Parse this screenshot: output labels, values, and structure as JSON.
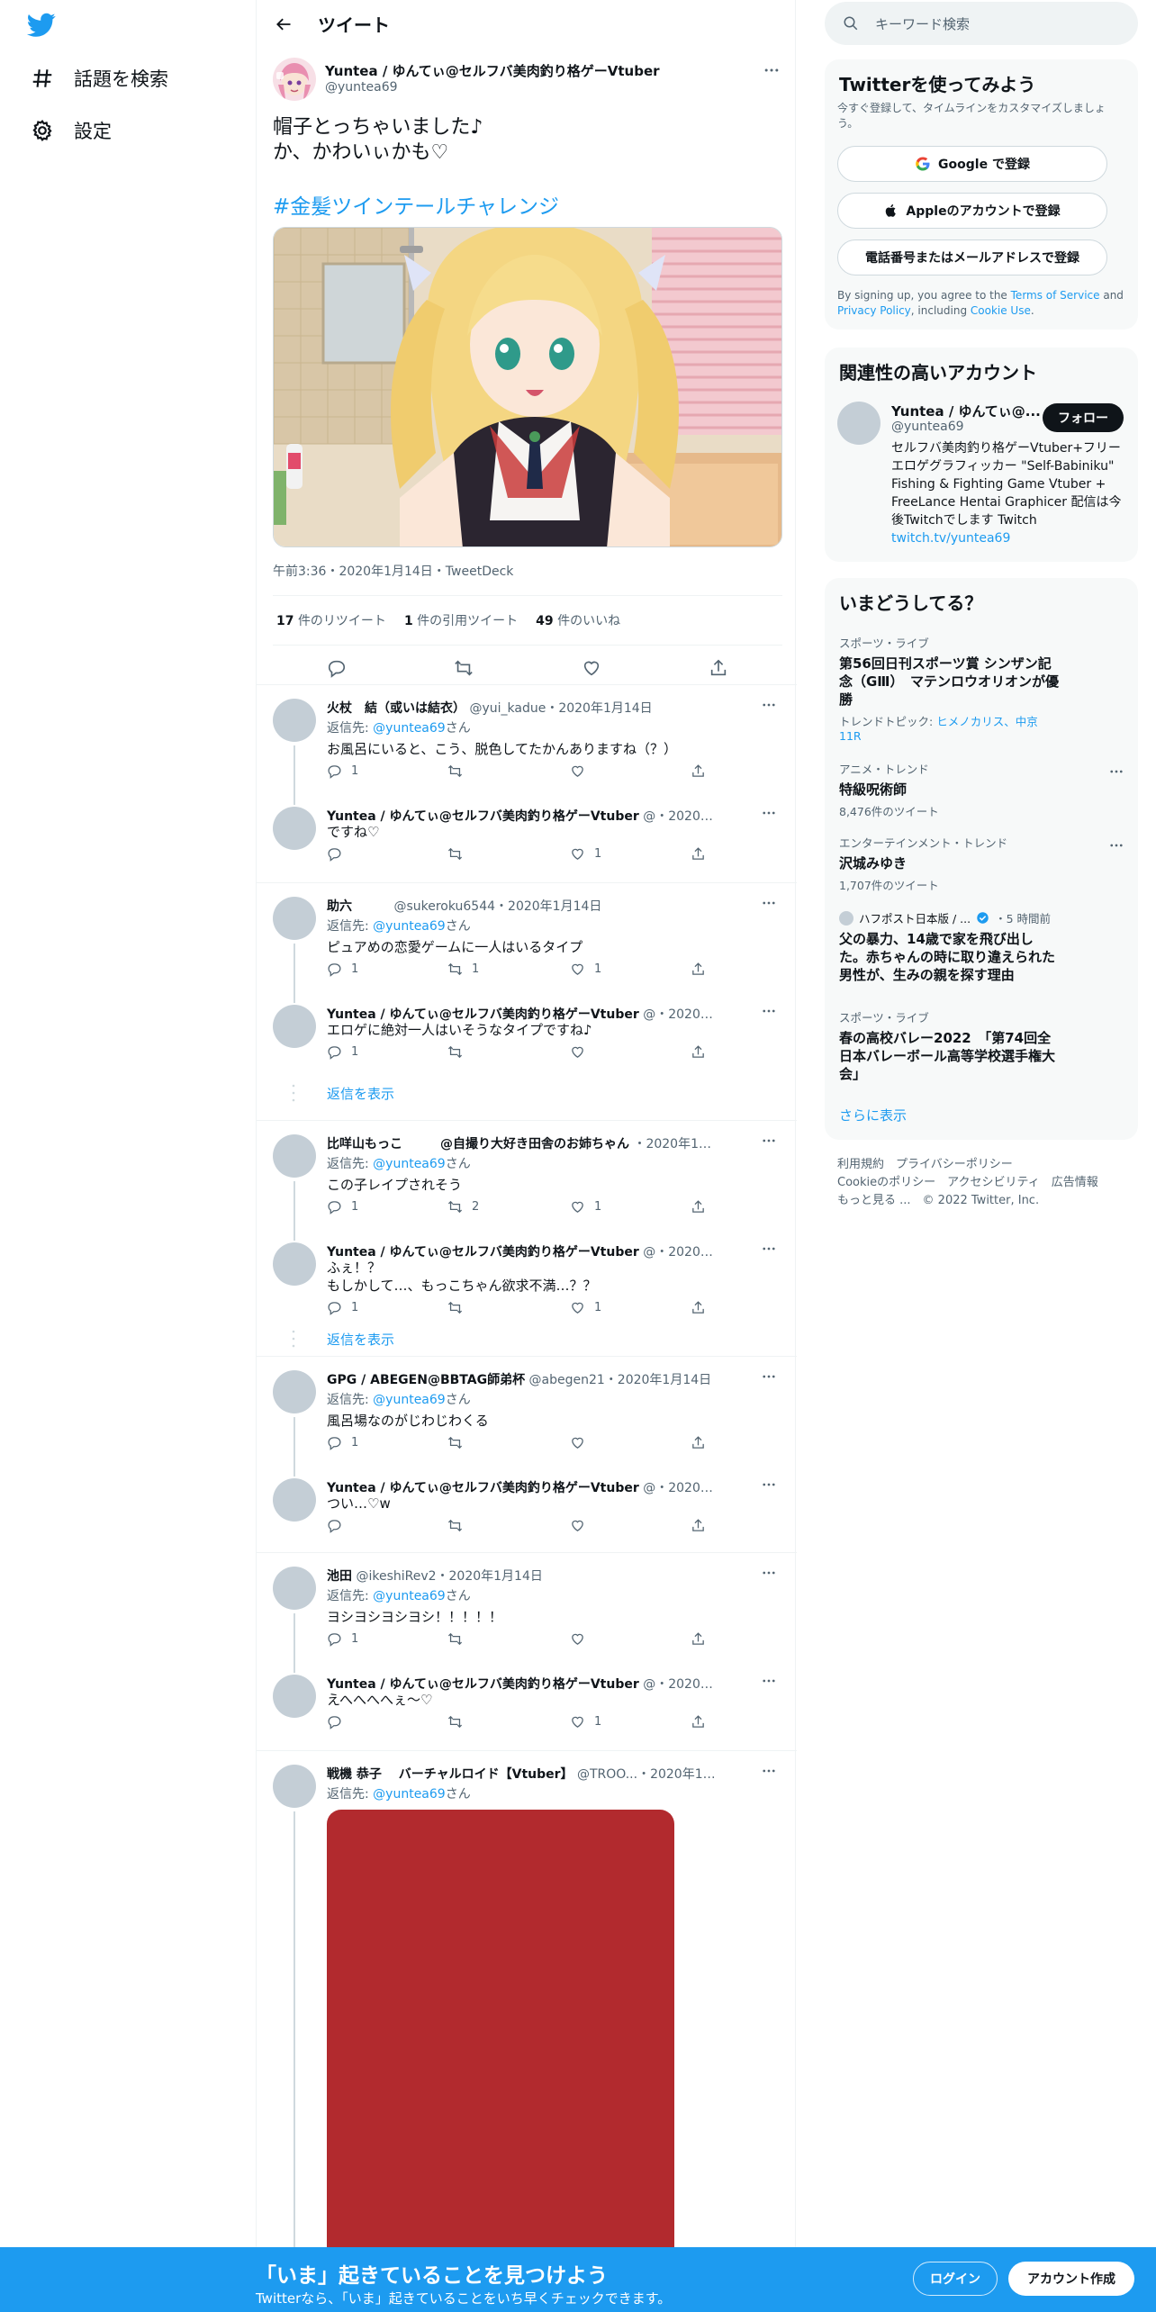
{
  "nav": {
    "explore_label": "話題を検索",
    "settings_label": "設定"
  },
  "header": {
    "title": "ツイート"
  },
  "main_tweet": {
    "display_name": "Yuntea / ゆんてぃ@セルフバ美肉釣り格ゲーVtuber",
    "handle": "@yuntea69",
    "text": "帽子とっちゃいました♪\nか、かわいぃかも♡",
    "hashtag": "#金髪ツインテールチャレンジ",
    "meta": "午前3:36・2020年1月14日・TweetDeck",
    "retweets": "17",
    "retweets_label": "件のリツイート",
    "quotes": "1",
    "quotes_label": "件の引用ツイート",
    "likes": "49",
    "likes_label": "件のいいね"
  },
  "replies": [
    {
      "name": "火杖　結（或いは結衣）",
      "meta": "@yui_kadue・2020年1月14日",
      "replyto_prefix": "返信先: ",
      "replyto": "@yuntea69",
      "replyto_suffix": "さん",
      "text": "お風呂にいると、こう、脱色してたかんありますね（？）",
      "reply_count": "1",
      "rt_count": "",
      "like_count": ""
    },
    {
      "name": "Yuntea / ゆんてぃ@セルフバ美肉釣り格ゲーVtuber",
      "meta": "@・2020年1月14日",
      "text": "ですね♡",
      "reply_count": "",
      "rt_count": "",
      "like_count": "1"
    },
    {
      "name": "助六",
      "meta": "　　　@sukeroku6544・2020年1月14日",
      "replyto_prefix": "返信先: ",
      "replyto": "@yuntea69",
      "replyto_suffix": "さん",
      "text": "ピュアめの恋愛ゲームに一人はいるタイプ",
      "reply_count": "1",
      "rt_count": "1",
      "like_count": "1"
    },
    {
      "name": "Yuntea / ゆんてぃ@セルフバ美肉釣り格ゲーVtuber",
      "meta": "@・2020年1月14日",
      "text": "エロゲに絶対一人はいそうなタイプですね♪",
      "reply_count": "1",
      "rt_count": "",
      "like_count": "",
      "show_more": "返信を表示"
    },
    {
      "name": "比咩山もっこ　　　@自撮り大好き田舎のお姉ちゃん",
      "meta": "・2020年1月14日",
      "replyto_prefix": "返信先: ",
      "replyto": "@yuntea69",
      "replyto_suffix": "さん",
      "text": "この子レイプされそう",
      "reply_count": "1",
      "rt_count": "2",
      "like_count": "1"
    },
    {
      "name": "Yuntea / ゆんてぃ@セルフバ美肉釣り格ゲーVtuber",
      "meta": "@・2020年1月14日",
      "text": "ふぇ！？\nもしかして…、もっこちゃん欲求不満…？？",
      "reply_count": "1",
      "rt_count": "",
      "like_count": "1",
      "show_more": "返信を表示"
    },
    {
      "name": "GPG / ABEGEN@BBTAG師弟杯",
      "meta": "@abegen21・2020年1月14日",
      "replyto_prefix": "返信先: ",
      "replyto": "@yuntea69",
      "replyto_suffix": "さん",
      "text": "風呂場なのがじわじわくる",
      "reply_count": "1",
      "rt_count": "",
      "like_count": ""
    },
    {
      "name": "Yuntea / ゆんてぃ@セルフバ美肉釣り格ゲーVtuber",
      "meta": "@・2020年1月14日",
      "text": "つい…♡w",
      "reply_count": "",
      "rt_count": "",
      "like_count": ""
    },
    {
      "name": "池田",
      "meta": "@ikeshiRev2・2020年1月14日",
      "replyto_prefix": "返信先: ",
      "replyto": "@yuntea69",
      "replyto_suffix": "さん",
      "text": "ヨシヨシヨシヨシ！！！！！",
      "reply_count": "1",
      "rt_count": "",
      "like_count": ""
    },
    {
      "name": "Yuntea / ゆんてぃ@セルフバ美肉釣り格ゲーVtuber",
      "meta": "@・2020年1月14日",
      "text": "えへへへへぇ～♡",
      "reply_count": "",
      "rt_count": "",
      "like_count": "1"
    },
    {
      "name": "戦機 恭子　 バーチャルロイド【Vtuber】",
      "meta": "@TROO...・2020年1月14日",
      "replyto_prefix": "返信先: ",
      "replyto": "@yuntea69",
      "replyto_suffix": "さん"
    }
  ],
  "search": {
    "placeholder": "キーワード検索"
  },
  "signup": {
    "title": "Twitterを使ってみよう",
    "subtitle": "今すぐ登録して、タイムラインをカスタマイズしましょう。",
    "google": "Google で登録",
    "apple": "Appleのアカウントで登録",
    "phone": "電話番号またはメールアドレスで登録",
    "terms_1": "By signing up, you agree to the ",
    "terms_link1": "Terms of Service",
    "terms_2": " and ",
    "terms_link2": "Privacy Policy",
    "terms_3": ", including ",
    "terms_link3": "Cookie Use",
    "terms_4": "."
  },
  "related": {
    "title": "関連性の高いアカウント",
    "name": "Yuntea / ゆんてぃ@...",
    "handle": "@yuntea69",
    "follow": "フォロー",
    "bio": "セルフバ美肉釣り格ゲーVtuber+フリーエロゲグラフィッカー \"Self-Babiniku\" Fishing & Fighting Game Vtuber + FreeLance Hentai Graphicer 配信は今後Twitchでします Twitch",
    "link": "twitch.tv/yuntea69"
  },
  "trends": {
    "title": "いまどうしてる？",
    "items": [
      {
        "cat": "スポーツ・ライブ",
        "name": "第56回日刊スポーツ賞 シンザン記念（GⅢ）　マテンロウオリオンが優勝",
        "sub_prefix": "トレンドトピック: ",
        "sub_link": "ヒメノカリス、中京11R"
      },
      {
        "cat": "アニメ・トレンド",
        "name": "特級呪術師",
        "sub": "8,476件のツイート"
      },
      {
        "cat": "エンターテインメント・トレンド",
        "name": "沢城みゆき",
        "sub": "1,707件のツイート"
      },
      {
        "source": "ハフポスト日本版 / ...",
        "time": "・5 時間前",
        "name": "父の暴力、14歳で家を飛び出した。赤ちゃんの時に取り違えられた男性が、生みの親を探す理由"
      },
      {
        "cat": "スポーツ・ライブ",
        "name": "春の高校バレー2022　「第74回全日本バレーボール高等学校選手権大会」"
      }
    ],
    "show_more": "さらに表示"
  },
  "footer": {
    "l1": "利用規約",
    "l2": "プライバシーポリシー",
    "l3": "Cookieのポリシー",
    "l4": "アクセシビリティ",
    "l5": "広告情報",
    "l6": "もっと見る ...",
    "l7": "© 2022 Twitter, Inc."
  },
  "bottom": {
    "title": "「いま」起きていることを見つけよう",
    "subtitle": "Twitterなら、「いま」起きていることをいち早くチェックできます。",
    "login": "ログイン",
    "signup": "アカウント作成"
  },
  "colors": {
    "accent": "#1d9bf0",
    "text": "#0f1419",
    "muted": "#536471",
    "media_red": "#b22a2e"
  }
}
